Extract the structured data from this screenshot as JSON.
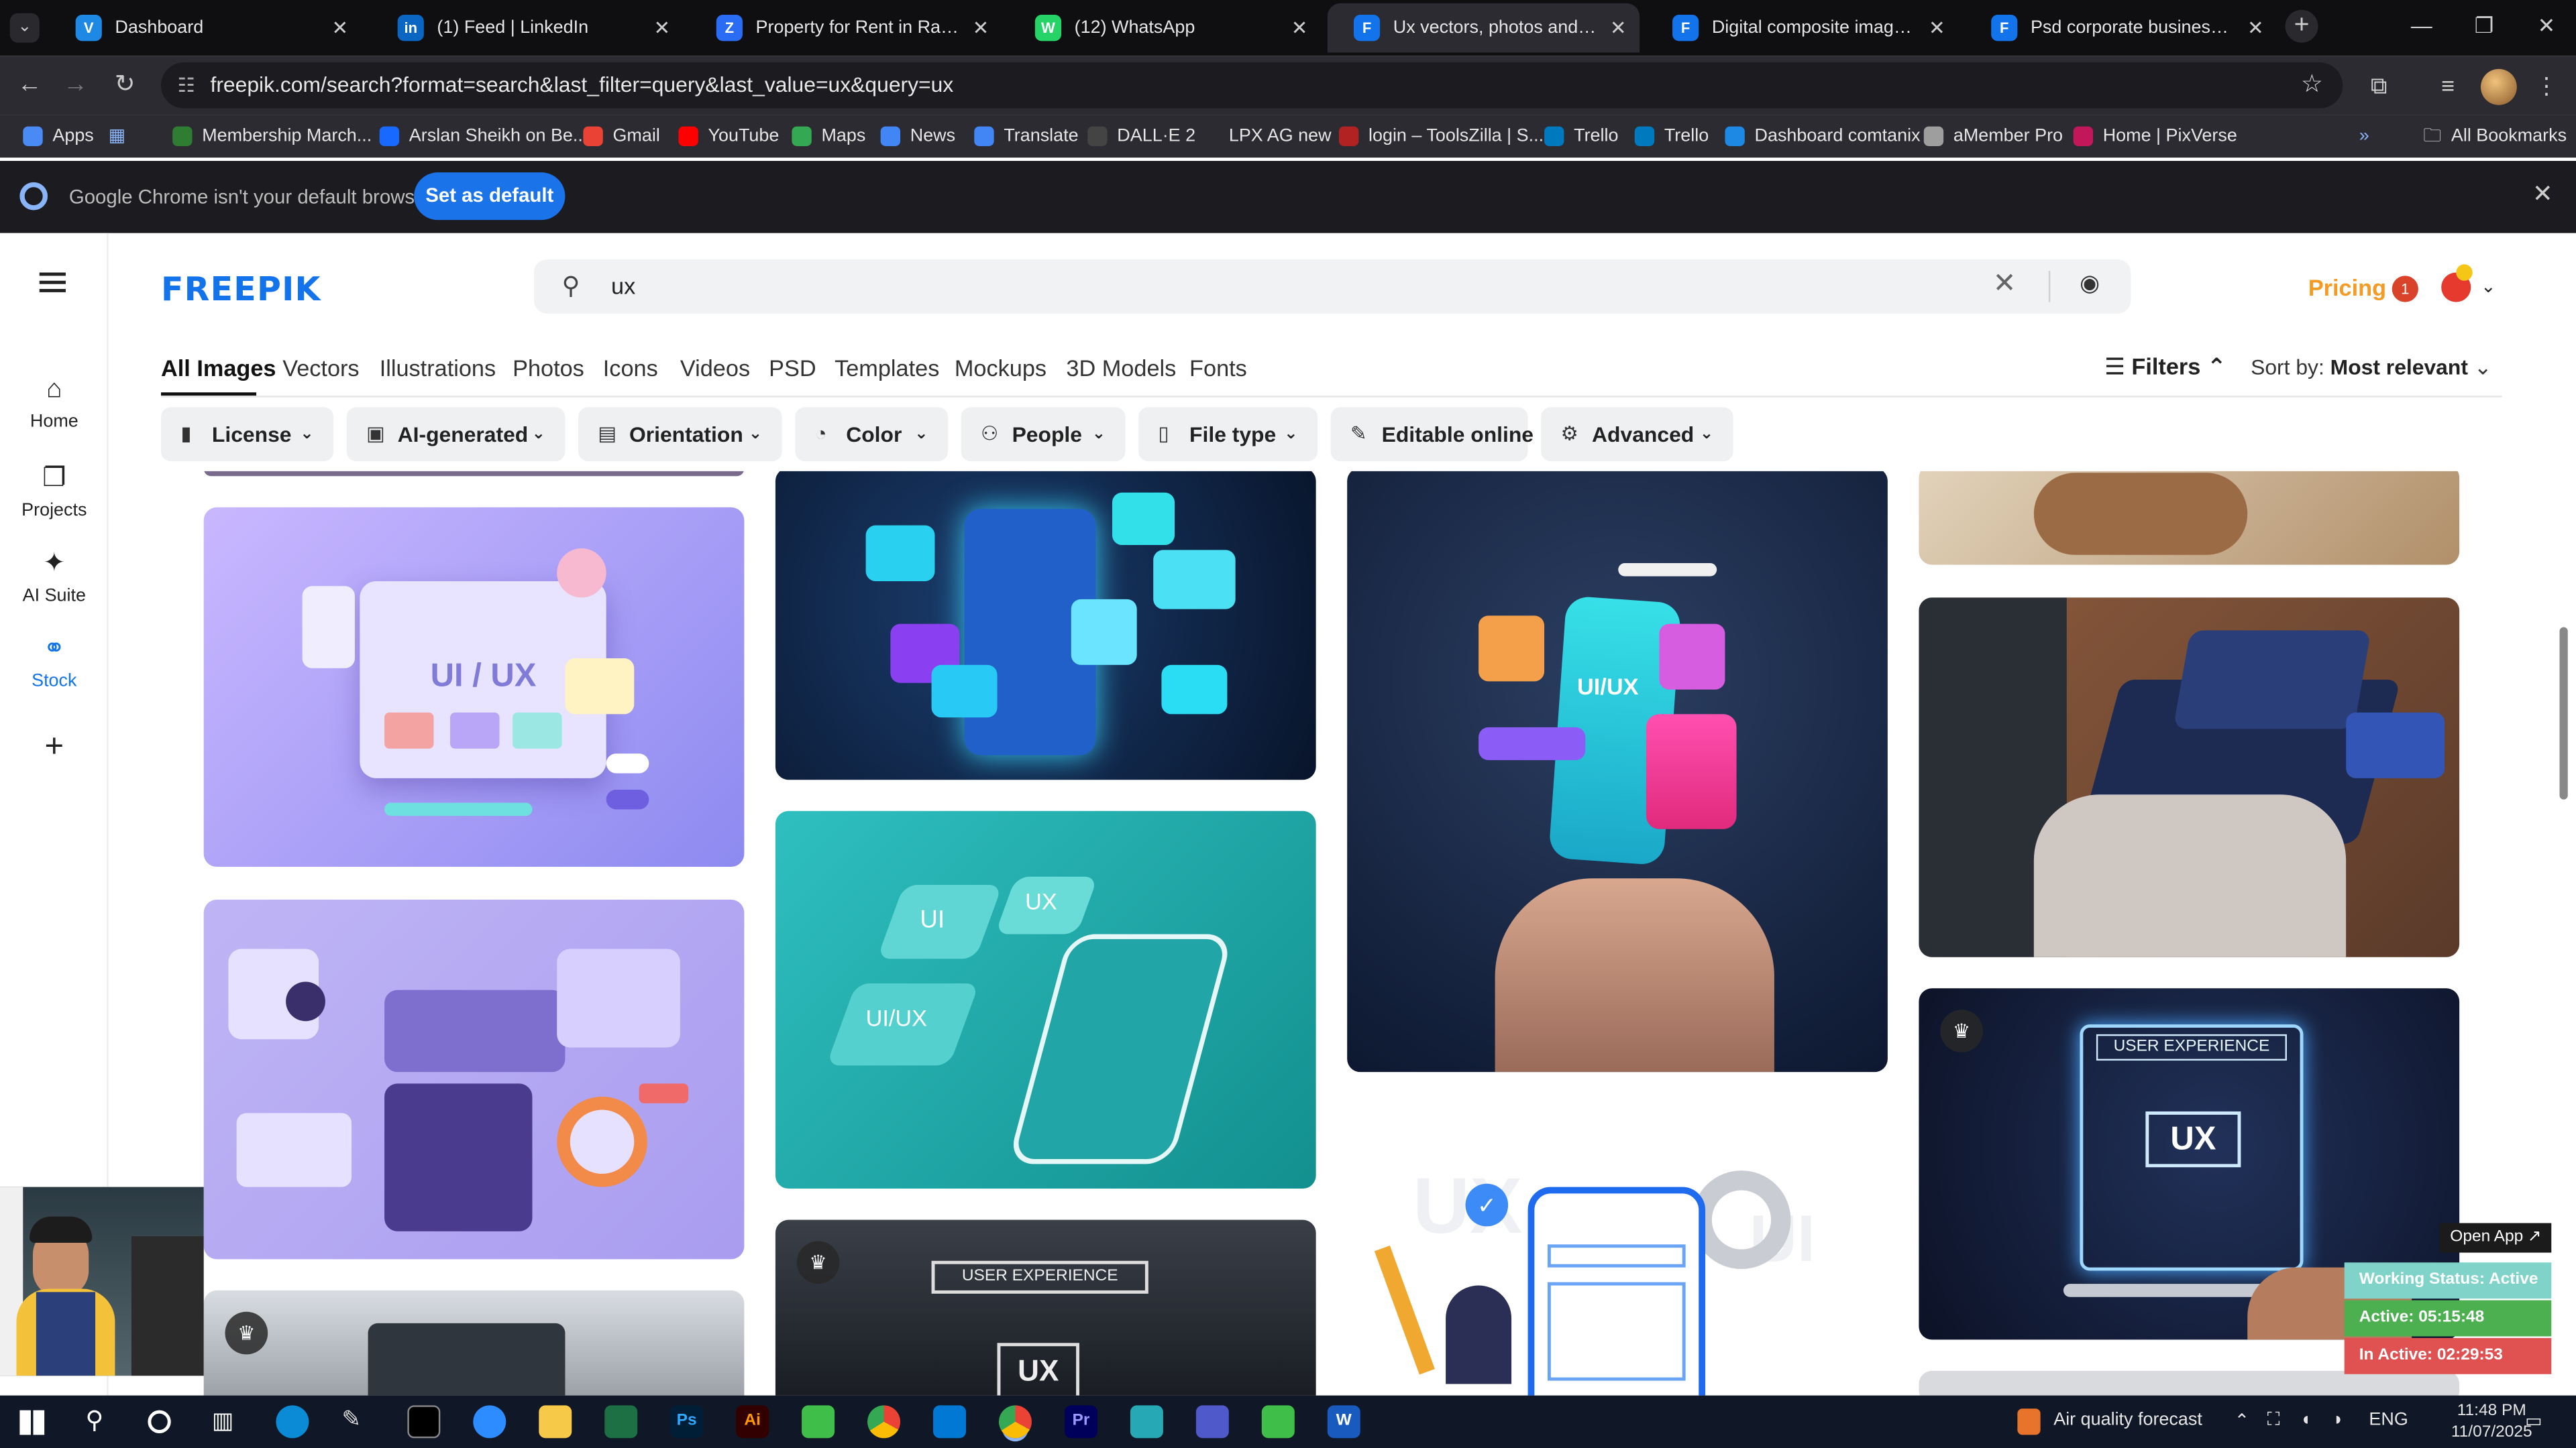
{
  "browser": {
    "tabs": [
      {
        "label": "Dashboard",
        "color": "#1e88e5",
        "glyph": "V"
      },
      {
        "label": "(1) Feed | LinkedIn",
        "color": "#0a66c2",
        "glyph": "in"
      },
      {
        "label": "Property for Rent in Rawalpindi",
        "color": "#2a6df4",
        "glyph": "Z"
      },
      {
        "label": "(12) WhatsApp",
        "color": "#25d366",
        "glyph": "W"
      },
      {
        "label": "Ux vectors, photos and PSD files",
        "color": "#1273eb",
        "glyph": "F"
      },
      {
        "label": "Digital composite image of gra",
        "color": "#1273eb",
        "glyph": "F"
      },
      {
        "label": "Psd corporate business flyer de",
        "color": "#1273eb",
        "glyph": "F"
      }
    ],
    "active_tab": 4,
    "url": "freepik.com/search?format=search&last_filter=query&last_value=ux&query=ux",
    "bookmarks": [
      {
        "label": "Apps",
        "color": "#4a8af4"
      },
      {
        "label": "Membership March...",
        "color": "#2e7d32"
      },
      {
        "label": "Arslan Sheikh on Be...",
        "color": "#1769ff"
      },
      {
        "label": "Gmail",
        "color": "#ea4335"
      },
      {
        "label": "YouTube",
        "color": "#ff0000"
      },
      {
        "label": "Maps",
        "color": "#34a853"
      },
      {
        "label": "News",
        "color": "#4285f4"
      },
      {
        "label": "Translate",
        "color": "#4285f4"
      },
      {
        "label": "DALL·E 2",
        "color": "#444444"
      },
      {
        "label": "LPX AG new",
        "color": "#2b2b31"
      },
      {
        "label": "login – ToolsZilla | S...",
        "color": "#b22222"
      },
      {
        "label": "Trello",
        "color": "#0079bf"
      },
      {
        "label": "Trello",
        "color": "#0079bf"
      },
      {
        "label": "Dashboard comtanix",
        "color": "#1e88e5"
      },
      {
        "label": "aMember Pro",
        "color": "#9e9e9e"
      },
      {
        "label": "Home | PixVerse",
        "color": "#c2185b"
      }
    ],
    "all_bookmarks": "All Bookmarks",
    "infobar_message": "Google Chrome isn't your default browser",
    "infobar_button": "Set as default"
  },
  "freepik": {
    "logo": "FREEPIK",
    "search_query": "ux",
    "pricing": "Pricing",
    "notification_count": "1",
    "sidebar": [
      {
        "label": "Home",
        "icon": "home-icon"
      },
      {
        "label": "Projects",
        "icon": "folder-icon"
      },
      {
        "label": "AI Suite",
        "icon": "sparkle-icon"
      },
      {
        "label": "Stock",
        "icon": "stock-icon"
      }
    ],
    "categories": [
      "All Images",
      "Vectors",
      "Illustrations",
      "Photos",
      "Icons",
      "Videos",
      "PSD",
      "Templates",
      "Mockups",
      "3D Models",
      "Fonts"
    ],
    "filters_label": "Filters",
    "sort_label": "Sort by:",
    "sort_value": "Most relevant",
    "filter_pills": [
      "License",
      "AI-generated",
      "Orientation",
      "Color",
      "People",
      "File type",
      "Editable online",
      "Advanced"
    ]
  },
  "images": [
    {
      "label": "UI / UX"
    },
    {
      "label": "UI"
    },
    {
      "label": "UX"
    },
    {
      "label": "UI/UX"
    },
    {
      "label": "UI/UX"
    },
    {
      "label": "USER EXPERIENCE"
    },
    {
      "label": "UX"
    },
    {
      "label": "USER EXPERIENCE"
    },
    {
      "label": "UX"
    },
    {
      "label": "UX"
    },
    {
      "label": "UI"
    }
  ],
  "widget": {
    "open": "Open App ↗",
    "working": "Working Status: Active",
    "active": "Active: 05:15:48",
    "inactive": "In Active: 02:29:53"
  },
  "taskbar": {
    "weather": "Air quality forecast",
    "lang": "ENG",
    "time": "11:48 PM",
    "date": "11/07/2025"
  }
}
